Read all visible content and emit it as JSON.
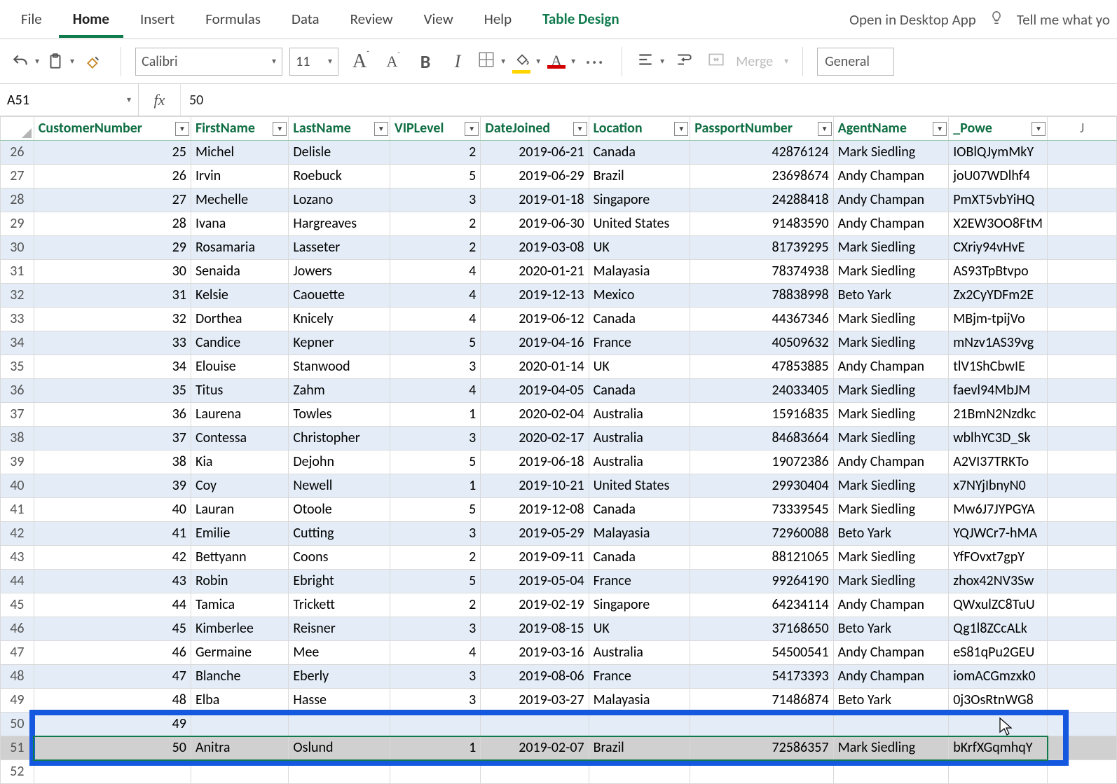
{
  "tabs": {
    "file": "File",
    "home": "Home",
    "insert": "Insert",
    "formulas": "Formulas",
    "data": "Data",
    "review": "Review",
    "view": "View",
    "help": "Help",
    "table_design": "Table Design",
    "open_desktop": "Open in Desktop App",
    "tell_me": "Tell me what yo"
  },
  "ribbon": {
    "font_name": "Calibri",
    "font_size": "11",
    "merge_label": "Merge",
    "number_format": "General"
  },
  "formula_bar": {
    "name_box": "A51",
    "fx_label": "fx",
    "formula": "50"
  },
  "columns": [
    "CustomerNumber",
    "FirstName",
    "LastName",
    "VIPLevel",
    "DateJoined",
    "Location",
    "PassportNumber",
    "AgentName",
    "_Powe"
  ],
  "extra_col_letter": "J",
  "row_start": 26,
  "rows": [
    {
      "n": 25,
      "first": "Michel",
      "last": "Delisle",
      "vip": 2,
      "date": "2019-06-21",
      "loc": "Canada",
      "pass": 42876124,
      "agent": "Mark Siedling",
      "pow": "IOBlQJymMkY"
    },
    {
      "n": 26,
      "first": "Irvin",
      "last": "Roebuck",
      "vip": 5,
      "date": "2019-06-29",
      "loc": "Brazil",
      "pass": 23698674,
      "agent": "Andy Champan",
      "pow": "joU07WDlhf4"
    },
    {
      "n": 27,
      "first": "Mechelle",
      "last": "Lozano",
      "vip": 3,
      "date": "2019-01-18",
      "loc": "Singapore",
      "pass": 24288418,
      "agent": "Andy Champan",
      "pow": "PmXT5vbYiHQ"
    },
    {
      "n": 28,
      "first": "Ivana",
      "last": "Hargreaves",
      "vip": 2,
      "date": "2019-06-30",
      "loc": "United States",
      "pass": 91483590,
      "agent": "Andy Champan",
      "pow": "X2EW3OO8FtM"
    },
    {
      "n": 29,
      "first": "Rosamaria",
      "last": "Lasseter",
      "vip": 2,
      "date": "2019-03-08",
      "loc": "UK",
      "pass": 81739295,
      "agent": "Mark Siedling",
      "pow": "CXriy94vHvE"
    },
    {
      "n": 30,
      "first": "Senaida",
      "last": "Jowers",
      "vip": 4,
      "date": "2020-01-21",
      "loc": "Malayasia",
      "pass": 78374938,
      "agent": "Mark Siedling",
      "pow": "AS93TpBtvpo"
    },
    {
      "n": 31,
      "first": "Kelsie",
      "last": "Caouette",
      "vip": 4,
      "date": "2019-12-13",
      "loc": "Mexico",
      "pass": 78838998,
      "agent": "Beto Yark",
      "pow": "Zx2CyYDFm2E"
    },
    {
      "n": 32,
      "first": "Dorthea",
      "last": "Knicely",
      "vip": 4,
      "date": "2019-06-12",
      "loc": "Canada",
      "pass": 44367346,
      "agent": "Mark Siedling",
      "pow": "MBjm-tpijVo"
    },
    {
      "n": 33,
      "first": "Candice",
      "last": "Kepner",
      "vip": 5,
      "date": "2019-04-16",
      "loc": "France",
      "pass": 40509632,
      "agent": "Mark Siedling",
      "pow": "mNzv1AS39vg"
    },
    {
      "n": 34,
      "first": "Elouise",
      "last": "Stanwood",
      "vip": 3,
      "date": "2020-01-14",
      "loc": "UK",
      "pass": 47853885,
      "agent": "Andy Champan",
      "pow": "tlV1ShCbwIE"
    },
    {
      "n": 35,
      "first": "Titus",
      "last": "Zahm",
      "vip": 4,
      "date": "2019-04-05",
      "loc": "Canada",
      "pass": 24033405,
      "agent": "Mark Siedling",
      "pow": "faevl94MbJM"
    },
    {
      "n": 36,
      "first": "Laurena",
      "last": "Towles",
      "vip": 1,
      "date": "2020-02-04",
      "loc": "Australia",
      "pass": 15916835,
      "agent": "Mark Siedling",
      "pow": "21BmN2Nzdkc"
    },
    {
      "n": 37,
      "first": "Contessa",
      "last": "Christopher",
      "vip": 3,
      "date": "2020-02-17",
      "loc": "Australia",
      "pass": 84683664,
      "agent": "Mark Siedling",
      "pow": "wblhYC3D_Sk"
    },
    {
      "n": 38,
      "first": "Kia",
      "last": "Dejohn",
      "vip": 5,
      "date": "2019-06-18",
      "loc": "Australia",
      "pass": 19072386,
      "agent": "Andy Champan",
      "pow": "A2VI37TRKTo"
    },
    {
      "n": 39,
      "first": "Coy",
      "last": "Newell",
      "vip": 1,
      "date": "2019-10-21",
      "loc": "United States",
      "pass": 29930404,
      "agent": "Mark Siedling",
      "pow": "x7NYjIbnyN0"
    },
    {
      "n": 40,
      "first": "Lauran",
      "last": "Otoole",
      "vip": 5,
      "date": "2019-12-08",
      "loc": "Canada",
      "pass": 73339545,
      "agent": "Mark Siedling",
      "pow": "Mw6J7JYPGYA"
    },
    {
      "n": 41,
      "first": "Emilie",
      "last": "Cutting",
      "vip": 3,
      "date": "2019-05-29",
      "loc": "Malayasia",
      "pass": 72960088,
      "agent": "Beto Yark",
      "pow": "YQJWCr7-hMA"
    },
    {
      "n": 42,
      "first": "Bettyann",
      "last": "Coons",
      "vip": 2,
      "date": "2019-09-11",
      "loc": "Canada",
      "pass": 88121065,
      "agent": "Mark Siedling",
      "pow": "YfFOvxt7gpY"
    },
    {
      "n": 43,
      "first": "Robin",
      "last": "Ebright",
      "vip": 5,
      "date": "2019-05-04",
      "loc": "France",
      "pass": 99264190,
      "agent": "Mark Siedling",
      "pow": "zhox42NV3Sw"
    },
    {
      "n": 44,
      "first": "Tamica",
      "last": "Trickett",
      "vip": 2,
      "date": "2019-02-19",
      "loc": "Singapore",
      "pass": 64234114,
      "agent": "Andy Champan",
      "pow": "QWxulZC8TuU"
    },
    {
      "n": 45,
      "first": "Kimberlee",
      "last": "Reisner",
      "vip": 3,
      "date": "2019-08-15",
      "loc": "UK",
      "pass": 37168650,
      "agent": "Beto Yark",
      "pow": "Qg1l8ZCcALk"
    },
    {
      "n": 46,
      "first": "Germaine",
      "last": "Mee",
      "vip": 4,
      "date": "2019-03-16",
      "loc": "Australia",
      "pass": 54500541,
      "agent": "Andy Champan",
      "pow": "eS81qPu2GEU"
    },
    {
      "n": 47,
      "first": "Blanche",
      "last": "Eberly",
      "vip": 3,
      "date": "2019-08-06",
      "loc": "France",
      "pass": 54173393,
      "agent": "Andy Champan",
      "pow": "iomACGmzxk0"
    },
    {
      "n": 48,
      "first": "Elba",
      "last": "Hasse",
      "vip": 3,
      "date": "2019-03-27",
      "loc": "Malayasia",
      "pass": 71486874,
      "agent": "Beto Yark",
      "pow": "0j3OsRtnWG8"
    },
    {
      "n": 49,
      "first": "",
      "last": "",
      "vip": "",
      "date": "",
      "loc": "",
      "pass": "",
      "agent": "",
      "pow": ""
    },
    {
      "n": 50,
      "first": "Anitra",
      "last": "Oslund",
      "vip": 1,
      "date": "2019-02-07",
      "loc": "Brazil",
      "pass": 72586357,
      "agent": "Mark Siedling",
      "pow": "bKrfXGqmhqY"
    }
  ],
  "trailing_row": 52
}
